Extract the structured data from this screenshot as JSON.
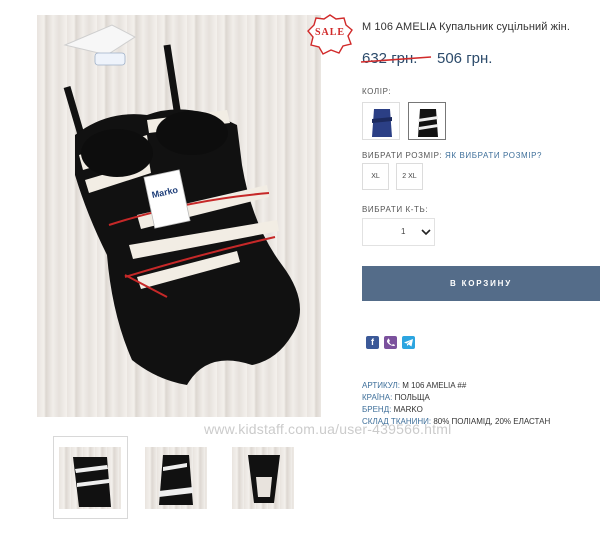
{
  "product": {
    "title": "M 106 AMELIA Купальник суцільний жін.",
    "old_price": "632 грн.",
    "new_price": "506 грн.",
    "sale_badge": "SALE"
  },
  "color": {
    "label": "КОЛІР:"
  },
  "size": {
    "label": "ВИБРАТИ РОЗМІР:",
    "help_link": "ЯК ВИБРАТИ РОЗМІР?",
    "options": [
      "XL",
      "2 XL"
    ]
  },
  "quantity": {
    "label": "ВИБРАТИ К-ТЬ:",
    "value": "1"
  },
  "cart_button": "В КОРЗИНУ",
  "specs": [
    {
      "key": "АРТИКУЛ:",
      "value": " M 106 AMELIA ##"
    },
    {
      "key": "КРАЇНА:",
      "value": " ПОЛЬЩА"
    },
    {
      "key": "БРЕНД:",
      "value": " MARKO"
    },
    {
      "key": "СКЛАД ТКАНИНИ:",
      "value": " 80% ПОЛІАМІД, 20% ЕЛАСТАН"
    }
  ],
  "watermark": "www.kidstaff.com.ua/user-439566.html",
  "tag_text": "Marko",
  "colors": {
    "accent": "#546c89",
    "price": "#2c4b6b",
    "sale_red": "#d12a2a",
    "link": "#3e6f9a"
  },
  "icons": [
    "facebook-icon",
    "viber-icon",
    "telegram-icon",
    "chevron-down-icon"
  ]
}
